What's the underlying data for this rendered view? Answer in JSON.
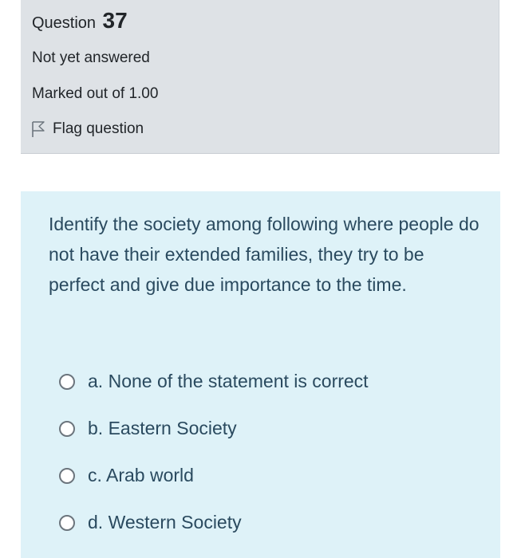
{
  "question_info": {
    "heading_word": "Question",
    "number": "37",
    "state": "Not yet answered",
    "grade": "Marked out of 1.00",
    "flag_label": "Flag question"
  },
  "question": {
    "text": "Identify the society among following where people do not have their extended families, they try to be perfect and give due importance to the time.",
    "options": [
      {
        "letter": "a.",
        "text": "None of the statement is correct"
      },
      {
        "letter": "b.",
        "text": "Eastern Society"
      },
      {
        "letter": "c.",
        "text": "Arab world"
      },
      {
        "letter": "d.",
        "text": "Western Society"
      }
    ]
  },
  "colors": {
    "info_bg": "#dee2e6",
    "formulation_bg": "#def2f8",
    "question_text": "#2a4a5f"
  },
  "icons": {
    "flag": "flag-outline-icon",
    "radio": "radio-unchecked-icon"
  }
}
